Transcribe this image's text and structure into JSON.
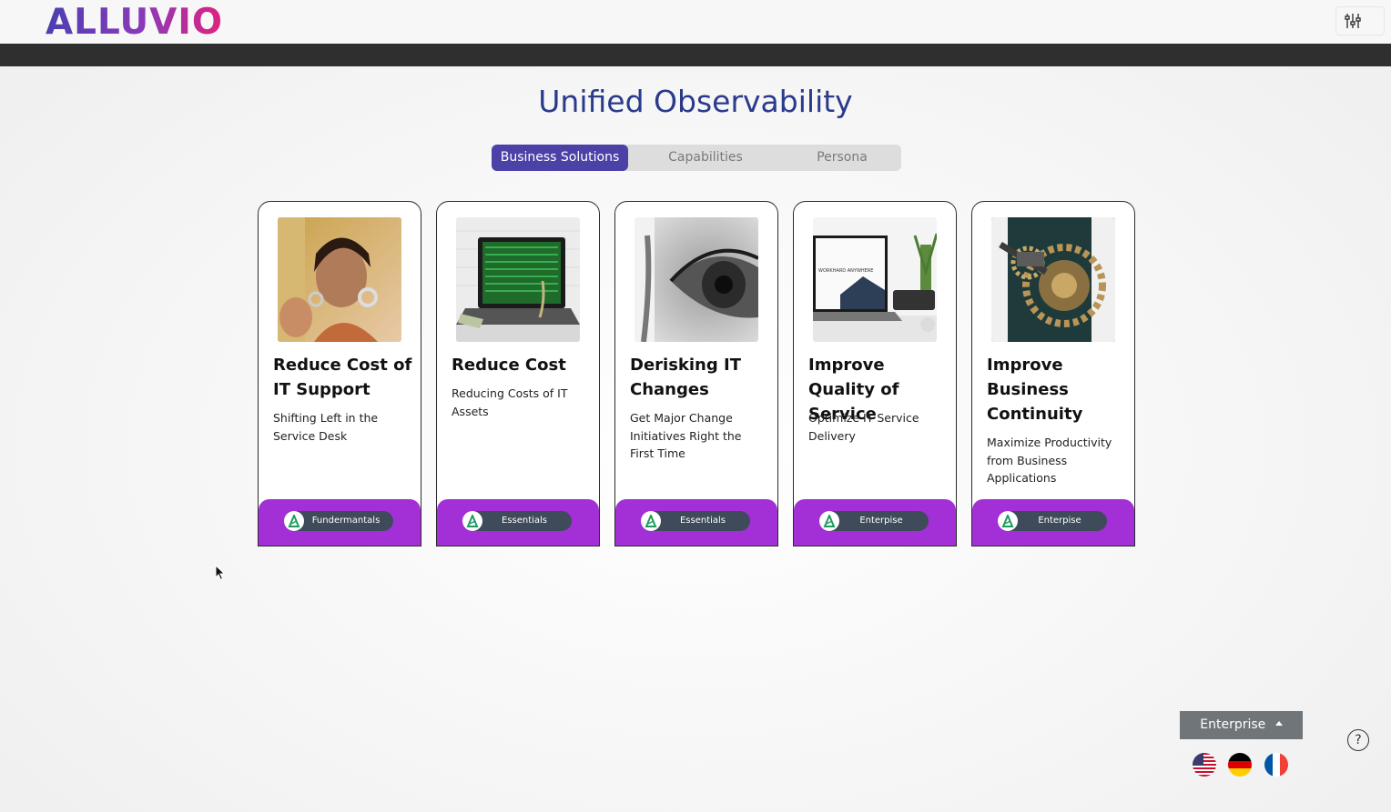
{
  "header": {
    "logo_text": "ALLUVIO",
    "settings_icon": "sliders-icon"
  },
  "main": {
    "title": "Unified Observability",
    "tabs": [
      {
        "label": "Business Solutions",
        "active": true
      },
      {
        "label": "Capabilities",
        "active": false
      },
      {
        "label": "Persona",
        "active": false
      }
    ],
    "cards": [
      {
        "title": "Reduce Cost of IT Support",
        "description": "Shifting Left in the Service Desk",
        "badge": "Fundermantals",
        "image": "call-center-agent-photo"
      },
      {
        "title": "Reduce Cost",
        "description": "Reducing Costs of IT Assets",
        "badge": "Essentials",
        "image": "laptop-with-money-photo"
      },
      {
        "title": "Derisking IT Changes",
        "description": "Get Major Change Initiatives Right the First Time",
        "badge": "Essentials",
        "image": "eye-closeup-photo"
      },
      {
        "title": "Improve Quality of Service",
        "description": "Optimize IT Service Delivery",
        "badge": "Enterpise",
        "image": "laptop-workspace-photo",
        "image_caption": "WORKHARD ANYWHERE"
      },
      {
        "title": "Improve Business Continuity",
        "description": "Maximize Productivity from Business Applications",
        "badge": "Enterpise",
        "image": "clockwork-gears-photo"
      }
    ]
  },
  "footer": {
    "edition_button": "Enterprise",
    "help_label": "?",
    "languages": [
      "us-flag-icon",
      "de-flag-icon",
      "fr-flag-icon"
    ]
  },
  "colors": {
    "accent": "#4b41a6",
    "card_footer": "#a230d6",
    "title": "#2a3a8c"
  }
}
